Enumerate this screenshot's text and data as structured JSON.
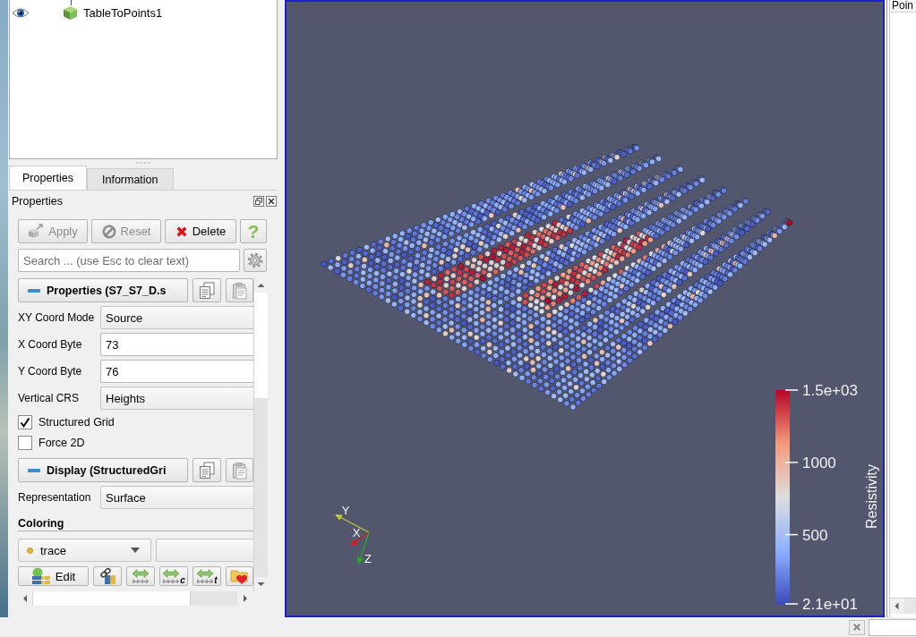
{
  "pipeline_browser": {
    "items": [
      {
        "label": "TableToPoints1",
        "visible": true
      }
    ]
  },
  "tabs": [
    {
      "label": "Properties",
      "selected": true
    },
    {
      "label": "Information",
      "selected": false
    }
  ],
  "properties_panel": {
    "title": "Properties",
    "buttons": [
      {
        "kind": "apply",
        "label": "Apply",
        "disabled": true
      },
      {
        "kind": "reset",
        "label": "Reset",
        "disabled": true
      },
      {
        "kind": "delete",
        "label": "Delete",
        "disabled": false
      },
      {
        "kind": "help",
        "label": "?",
        "disabled": false
      }
    ],
    "search": {
      "placeholder": "Search ... (use Esc to clear text)"
    },
    "sections": [
      {
        "title": "Properties (S7_S7_D.s",
        "expanded": true,
        "rows": [
          {
            "kind": "combo",
            "label": "XY Coord Mode",
            "value": "Source"
          },
          {
            "kind": "number",
            "label": "X Coord Byte",
            "value": "73"
          },
          {
            "kind": "number",
            "label": "Y Coord Byte",
            "value": "76"
          },
          {
            "kind": "combo",
            "label": "Vertical CRS",
            "value": "Heights"
          },
          {
            "kind": "checkbox",
            "label": "Structured Grid",
            "checked": true
          },
          {
            "kind": "checkbox",
            "label": "Force 2D",
            "checked": false
          }
        ]
      },
      {
        "title": "Display (StructuredGri",
        "expanded": true,
        "rows": [
          {
            "kind": "combo",
            "label": "Representation",
            "value": "Surface"
          },
          {
            "kind": "heading",
            "label": "Coloring"
          },
          {
            "kind": "color_by",
            "value": "trace"
          },
          {
            "kind": "toolbar",
            "buttons": [
              {
                "kind": "edit",
                "label": "Edit"
              },
              {
                "kind": "link"
              },
              {
                "kind": "rescale"
              },
              {
                "kind": "rescale_custom",
                "label": "c"
              },
              {
                "kind": "rescale_time",
                "label": "t"
              },
              {
                "kind": "favorites"
              }
            ]
          }
        ]
      }
    ]
  },
  "render_view": {
    "selected": true,
    "color_legend": {
      "title": "Resistivity",
      "labels": [
        "1.5e+03",
        "1000",
        "500",
        "2.1e+01"
      ]
    },
    "orientation_axes": [
      {
        "label": "Y",
        "color": "#c8c832"
      },
      {
        "label": "X",
        "color": "#e01818"
      },
      {
        "label": "Z",
        "color": "#22b022"
      }
    ]
  },
  "spreadsheet_view": {
    "columns": [
      "Poin"
    ]
  }
}
